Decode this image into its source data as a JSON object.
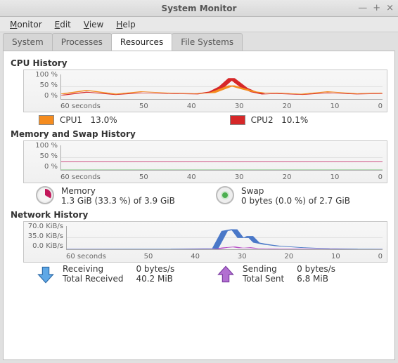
{
  "window": {
    "title": "System Monitor"
  },
  "menubar": [
    {
      "label": "Monitor",
      "accel": "M"
    },
    {
      "label": "Edit",
      "accel": "E"
    },
    {
      "label": "View",
      "accel": "V"
    },
    {
      "label": "Help",
      "accel": "H"
    }
  ],
  "tabs": [
    {
      "label": "System",
      "active": false
    },
    {
      "label": "Processes",
      "active": false
    },
    {
      "label": "Resources",
      "active": true
    },
    {
      "label": "File Systems",
      "active": false
    }
  ],
  "cpu": {
    "title": "CPU History",
    "yticks": [
      "100 %",
      "50 %",
      "0 %"
    ],
    "xaxis_label": "60 seconds",
    "xticks": [
      "50",
      "40",
      "30",
      "20",
      "10",
      "0"
    ],
    "legend": [
      {
        "name": "CPU1",
        "value": "13.0%",
        "color": "#f58c1f"
      },
      {
        "name": "CPU2",
        "value": "10.1%",
        "color": "#d62728"
      }
    ]
  },
  "mem": {
    "title": "Memory and Swap History",
    "yticks": [
      "100 %",
      "50 %",
      "0 %"
    ],
    "xaxis_label": "60 seconds",
    "xticks": [
      "50",
      "40",
      "30",
      "20",
      "10",
      "0"
    ],
    "memory": {
      "label": "Memory",
      "value": "1.3 GiB (33.3 %) of 3.9 GiB"
    },
    "swap": {
      "label": "Swap",
      "value": "0 bytes (0.0 %) of 2.7 GiB"
    }
  },
  "net": {
    "title": "Network History",
    "yticks": [
      "70.0 KiB/s",
      "35.0 KiB/s",
      "0.0 KiB/s"
    ],
    "xaxis_label": "60 seconds",
    "xticks": [
      "50",
      "40",
      "30",
      "20",
      "10",
      "0"
    ],
    "recv": {
      "label": "Receiving",
      "rate": "0 bytes/s",
      "total_label": "Total Received",
      "total": "40.2 MiB"
    },
    "send": {
      "label": "Sending",
      "rate": "0 bytes/s",
      "total_label": "Total Sent",
      "total": "6.8 MiB"
    }
  },
  "chart_data": [
    {
      "type": "line",
      "title": "CPU History",
      "xlabel": "seconds",
      "ylabel": "%",
      "xlim": [
        60,
        0
      ],
      "ylim": [
        0,
        100
      ],
      "x": [
        60,
        55,
        50,
        45,
        40,
        35,
        32,
        30,
        28,
        26,
        24,
        22,
        20,
        15,
        10,
        5,
        0
      ],
      "series": [
        {
          "name": "CPU1",
          "color": "#f58c1f",
          "values": [
            20,
            35,
            20,
            30,
            25,
            22,
            25,
            40,
            55,
            40,
            30,
            25,
            25,
            20,
            30,
            22,
            25
          ]
        },
        {
          "name": "CPU2",
          "color": "#d62728",
          "values": [
            15,
            28,
            18,
            25,
            22,
            20,
            30,
            50,
            85,
            45,
            28,
            20,
            22,
            18,
            25,
            20,
            22
          ]
        }
      ]
    },
    {
      "type": "line",
      "title": "Memory and Swap History",
      "xlabel": "seconds",
      "ylabel": "%",
      "xlim": [
        60,
        0
      ],
      "ylim": [
        0,
        100
      ],
      "x": [
        60,
        0
      ],
      "series": [
        {
          "name": "Memory",
          "color": "#c2185b",
          "values": [
            33.3,
            33.3
          ]
        },
        {
          "name": "Swap",
          "color": "#4caf50",
          "values": [
            0.0,
            0.0
          ]
        }
      ]
    },
    {
      "type": "line",
      "title": "Network History",
      "xlabel": "seconds",
      "ylabel": "KiB/s",
      "xlim": [
        60,
        0
      ],
      "ylim": [
        0,
        70
      ],
      "x": [
        60,
        40,
        32,
        30,
        28,
        27,
        26,
        25,
        24,
        22,
        20,
        15,
        10,
        5,
        0
      ],
      "series": [
        {
          "name": "Receiving",
          "color": "#4a78c8",
          "values": [
            0,
            1,
            2,
            55,
            60,
            35,
            35,
            40,
            20,
            15,
            10,
            5,
            2,
            1,
            0
          ]
        },
        {
          "name": "Sending",
          "color": "#b94fc8",
          "values": [
            0,
            0,
            0,
            5,
            7,
            4,
            4,
            5,
            3,
            2,
            1,
            1,
            0,
            0,
            0
          ]
        }
      ]
    }
  ]
}
